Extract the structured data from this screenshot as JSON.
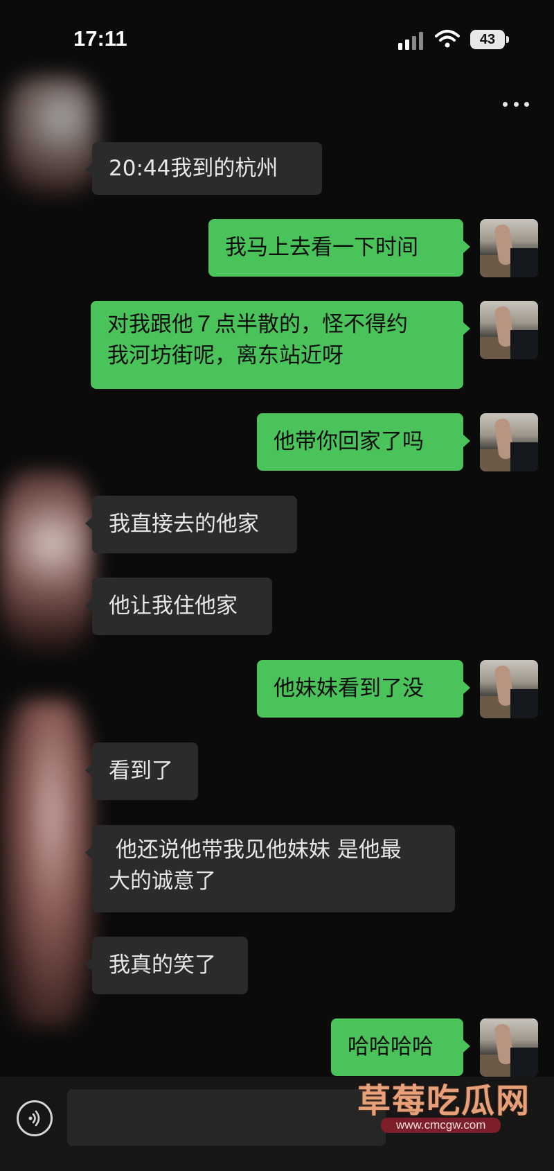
{
  "status_bar": {
    "time": "17:11",
    "battery": "43"
  },
  "header": {
    "more_icon": "ellipsis-icon"
  },
  "messages": [
    {
      "side": "in",
      "text": "20:44我到的杭州"
    },
    {
      "side": "out",
      "text": "我马上去看一下时间"
    },
    {
      "side": "out",
      "line1": "对我跟他７点半散的，怪不得约",
      "line2": "我河坊街呢，离东站近呀"
    },
    {
      "side": "out",
      "text": "他带你回家了吗"
    },
    {
      "side": "in",
      "text": "我直接去的他家"
    },
    {
      "side": "in",
      "text": "他让我住他家"
    },
    {
      "side": "out",
      "text": "他妹妹看到了没"
    },
    {
      "side": "in",
      "text": "看到了"
    },
    {
      "side": "in",
      "line1": " 他还说他带我见他妹妹 是他最",
      "line2": "大的诚意了"
    },
    {
      "side": "in",
      "text": "我真的笑了"
    },
    {
      "side": "out",
      "text": "哈哈哈哈"
    }
  ],
  "input_bar": {
    "voice_icon": "voice-icon"
  },
  "watermark": {
    "title": "草莓吃瓜网",
    "url": "www.cmcgw.com"
  },
  "colors": {
    "outgoing_bubble": "#49c35a",
    "incoming_bubble": "#2b2b2b",
    "background": "#0b0b0b"
  }
}
